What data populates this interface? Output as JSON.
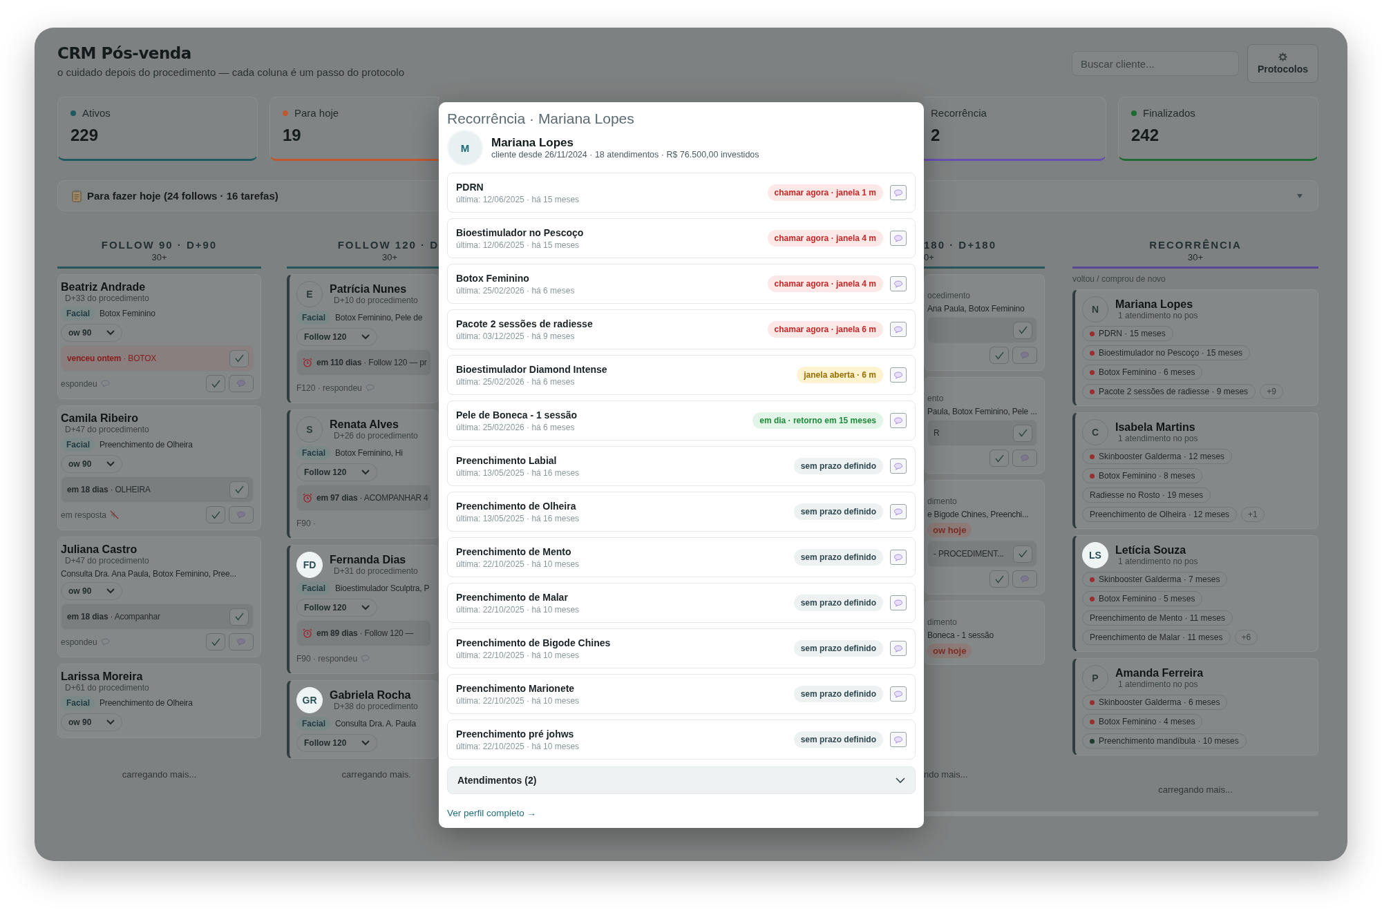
{
  "app": {
    "title": "CRM Pós-venda",
    "subtitle": "o cuidado depois do procedimento — cada coluna é um passo do protocolo",
    "search": {
      "placeholder": "Buscar cliente..."
    },
    "protocols_button": "Protocolos"
  },
  "left_stats": [
    {
      "label": "Ativos",
      "value": "229",
      "color": "#1f5a60"
    },
    {
      "label": "Para hoje",
      "value": "19",
      "color": "#c0582f"
    }
  ],
  "right_stats": [
    {
      "label": "Recorrência",
      "value": "2",
      "color": "#6b4fb0"
    },
    {
      "label": "Finalizados",
      "value": "242",
      "color": "#1d6b30"
    }
  ],
  "todo_bar": {
    "label": "Para fazer hoje (24 follows · 16 tarefas)"
  },
  "columns": [
    {
      "kind": "follow",
      "title": "FOLLOW 90 · D+90",
      "count": "30+",
      "footer": "carregando mais...",
      "cards": [
        {
          "accent": false,
          "name": "Beatriz Andrade",
          "since": "D+33 do procedimento",
          "tag": "Facial",
          "procedures": "Botox Feminino",
          "stage": "ow 90",
          "task": {
            "text": "**venceu ontem** · BOTOX",
            "overdue": true,
            "check": true
          },
          "footer": {
            "text": "espondeu",
            "kind": "replied"
          },
          "buttons": true
        },
        {
          "accent": false,
          "name": "Camila Ribeiro",
          "since": "D+47 do procedimento",
          "tag": "Facial",
          "procedures": "Preenchimento de Olheira",
          "stage": "ow 90",
          "task": {
            "text": "**em 18 dias** · OLHEIRA",
            "overdue": false,
            "check": true
          },
          "footer": {
            "text": "em resposta",
            "kind": "unanswered"
          },
          "buttons": true
        },
        {
          "accent": false,
          "name": "Juliana Castro",
          "since": "D+47 do procedimento",
          "procedures": "Consulta Dra. Ana Paula, Botox Feminino, Pree...",
          "stage": "ow 90",
          "task": {
            "text": "**em 18 dias** · Acompanhar",
            "overdue": false,
            "check": true
          },
          "footer": {
            "text": "espondeu",
            "kind": "replied"
          },
          "buttons": true
        },
        {
          "accent": false,
          "name": "Larissa Moreira",
          "since": "D+61 do procedimento",
          "tag": "Facial",
          "procedures": "Preenchimento de Olheira",
          "stage": "ow 90"
        }
      ]
    },
    {
      "kind": "follow",
      "title": "FOLLOW 120 · D",
      "count": "30+",
      "footer": "carregando mais.",
      "cards": [
        {
          "accent": true,
          "avatar": "E",
          "highlighted": false,
          "name": "Patrícia Nunes",
          "since": "D+10 do procedimento",
          "tag": "Facial",
          "procedures": "Botox Feminino, Pele de",
          "stage": "Follow 120",
          "task": {
            "text": "**em 110 dias** · Follow 120 — pr",
            "overdue": false,
            "alarm": true
          },
          "footer": {
            "text": "F120 · respondeu",
            "kind": "replied"
          }
        },
        {
          "accent": true,
          "avatar": "S",
          "highlighted": false,
          "name": "Renata Alves",
          "since": "D+26 do procedimento",
          "tag": "Facial",
          "procedures": "Botox Feminino, Hi",
          "stage": "Follow 120",
          "task": {
            "text": "**em 97 dias** · ACOMPANHAR 4",
            "overdue": false,
            "alarm": true
          },
          "footer": {
            "text": "F90 ·",
            "kind": "plain"
          }
        },
        {
          "accent": true,
          "avatar": "FD",
          "highlighted": true,
          "name": "Fernanda Dias",
          "since": "D+31 do procedimento",
          "tag": "Facial",
          "procedures": "Bioestimulador Sculptra, P",
          "stage": "Follow 120",
          "task": {
            "text": "**em 89 dias** · Follow 120 —",
            "overdue": false,
            "alarm": true
          },
          "footer": {
            "text": "F90 · respondeu",
            "kind": "replied"
          }
        },
        {
          "accent": true,
          "avatar": "GR",
          "highlighted": true,
          "name": "Gabriela Rocha",
          "since": "D+38 do procedimento",
          "tag": "Facial",
          "procedures": "Consulta Dra. A. Paula",
          "stage": "Follow 120"
        }
      ]
    },
    {
      "kind": "follow",
      "title": "180 · D+180",
      "count": "0+",
      "footer": "ndo mais...",
      "cards": [
        {
          "accent": false,
          "since": "ocedimento",
          "procedures": "Ana Paula, Botox Feminino",
          "task": {
            "overdue": false,
            "check": true
          },
          "buttons": true
        },
        {
          "accent": false,
          "since": "ento",
          "procedures": "Paula, Botox Feminino, Pele ...",
          "task": {
            "text": "R",
            "overdue": false,
            "check": true
          },
          "buttons": true
        },
        {
          "accent": false,
          "since": "dimento",
          "procedures": "e Bigode Chines, Preenchi...",
          "badge": "ow hoje",
          "task": {
            "text": "- PROCEDIMENT...",
            "overdue": false,
            "check": true
          },
          "buttons": true
        },
        {
          "accent": false,
          "since": "dimento",
          "procedures": "Boneca - 1 sessão",
          "badge": "ow hoje"
        }
      ]
    },
    {
      "kind": "recurrence",
      "title": "RECORRÊNCIA",
      "count": "30+",
      "note": "voltou / comprou de novo",
      "footer": "carregando mais...",
      "cards": [
        {
          "avatar": "N",
          "highlighted": false,
          "name": "Mariana Lopes",
          "since": "1 atendimento no pos",
          "chips": [
            {
              "text": "PDRN · 15 meses",
              "color": "#9a2d2d"
            },
            {
              "text": "Bioestimulador no Pescoço · 15 meses",
              "color": "#9a2d2d"
            },
            {
              "text": "Botox Feminino · 6 meses",
              "color": "#9a2d2d"
            },
            {
              "text": "Pacote 2 sessões de radiesse · 9 meses",
              "color": "#9a2d2d"
            }
          ],
          "more": "+9"
        },
        {
          "avatar": "C",
          "highlighted": false,
          "name": "Isabela Martins",
          "since": "1 atendimento no pos",
          "chips": [
            {
              "text": "Skinbooster Galderma · 12 meses",
              "color": "#9a2d2d"
            },
            {
              "text": "Botox Feminino · 8 meses",
              "color": "#9a2d2d"
            },
            {
              "text": "Radiesse no Rosto · 19 meses"
            },
            {
              "text": "Preenchimento de Olheira · 12 meses"
            }
          ],
          "more": "+1"
        },
        {
          "avatar": "LS",
          "highlighted": true,
          "name": "Letícia Souza",
          "since": "1 atendimento no pos",
          "chips": [
            {
              "text": "Skinbooster Galderma · 7 meses",
              "color": "#9a2d2d"
            },
            {
              "text": "Botox Feminino · 5 meses",
              "color": "#9a2d2d"
            },
            {
              "text": "Preenchimento de Mento · 11 meses"
            },
            {
              "text": "Preenchimento de Malar · 11 meses"
            }
          ],
          "more": "+6"
        },
        {
          "avatar": "P",
          "highlighted": false,
          "name": "Amanda Ferreira",
          "since": "1 atendimento no pos",
          "chips": [
            {
              "text": "Skinbooster Galderma · 6 meses",
              "color": "#9a2d2d"
            },
            {
              "text": "Botox Feminino · 4 meses",
              "color": "#9a2d2d"
            },
            {
              "text": "Preenchimento mandíbula · 10 meses",
              "color": "#1e3b30"
            }
          ]
        }
      ]
    }
  ],
  "modal": {
    "title": "Recorrência · Mariana Lopes",
    "client": {
      "initial": "M",
      "name": "Mariana Lopes",
      "meta": "cliente desde 26/11/2024 · 18 atendimentos · R$ 76.500,00 investidos"
    },
    "procedures": [
      {
        "name": "PDRN",
        "last": "última: 12/06/2025 · há 15 meses",
        "status": "chamar agora · janela 1 m",
        "kind": "urgent"
      },
      {
        "name": "Bioestimulador no Pescoço",
        "last": "última: 12/06/2025 · há 15 meses",
        "status": "chamar agora · janela 4 m",
        "kind": "urgent"
      },
      {
        "name": "Botox Feminino",
        "last": "última: 25/02/2026 · há 6 meses",
        "status": "chamar agora · janela 4 m",
        "kind": "urgent"
      },
      {
        "name": "Pacote 2 sessões de radiesse",
        "last": "última: 03/12/2025 · há 9 meses",
        "status": "chamar agora · janela 6 m",
        "kind": "urgent"
      },
      {
        "name": "Bioestimulador Diamond Intense",
        "last": "última: 25/02/2026 · há 6 meses",
        "status": "janela aberta · 6 m",
        "kind": "open"
      },
      {
        "name": "Pele de Boneca - 1 sessão",
        "last": "última: 25/02/2026 · há 6 meses",
        "status": "em dia · retorno em 15 meses",
        "kind": "ok"
      },
      {
        "name": "Preenchimento Labial",
        "last": "última: 13/05/2025 · há 16 meses",
        "status": "sem prazo definido",
        "kind": "none"
      },
      {
        "name": "Preenchimento de Olheira",
        "last": "última: 13/05/2025 · há 16 meses",
        "status": "sem prazo definido",
        "kind": "none"
      },
      {
        "name": "Preenchimento de Mento",
        "last": "última: 22/10/2025 · há 10 meses",
        "status": "sem prazo definido",
        "kind": "none"
      },
      {
        "name": "Preenchimento de Malar",
        "last": "última: 22/10/2025 · há 10 meses",
        "status": "sem prazo definido",
        "kind": "none"
      },
      {
        "name": "Preenchimento de Bigode Chines",
        "last": "última: 22/10/2025 · há 10 meses",
        "status": "sem prazo definido",
        "kind": "none"
      },
      {
        "name": "Preenchimento Marionete",
        "last": "última: 22/10/2025 · há 10 meses",
        "status": "sem prazo definido",
        "kind": "none"
      },
      {
        "name": "Preenchimento pré johws",
        "last": "última: 22/10/2025 · há 10 meses",
        "status": "sem prazo definido",
        "kind": "none"
      }
    ],
    "history": {
      "label": "Atendimentos (2)",
      "expanded": false
    },
    "link": "Ver perfil completo →"
  }
}
